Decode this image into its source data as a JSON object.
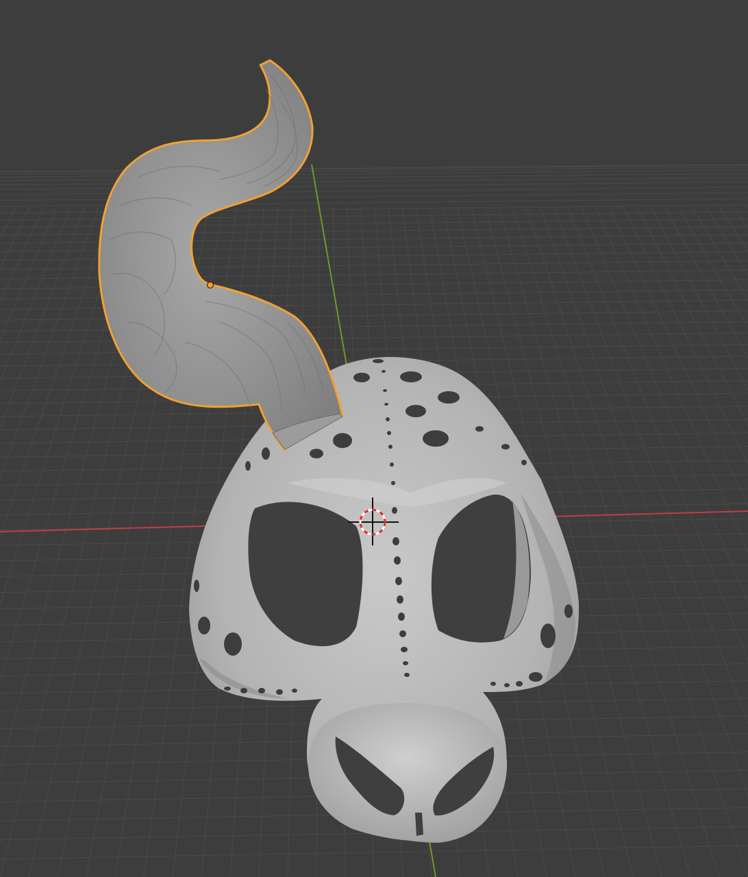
{
  "viewport": {
    "background": "#3d3d3d",
    "grid_color": "#4a4a4a",
    "x_axis_color": "#c43b4a",
    "y_axis_color": "#6c9a2a",
    "selection_outline_color": "#f2a033",
    "origin_dot_color": "#f2a033",
    "cursor_ring_colors": [
      "#e02a2a",
      "#ffffff"
    ],
    "cursor_cross_color": "#111111"
  },
  "scene": {
    "objects": [
      {
        "name": "horn",
        "selected": true,
        "surface_color": "#9a9a9a"
      },
      {
        "name": "mask",
        "selected": false,
        "surface_color": "#b6b6b6"
      }
    ],
    "icons": [
      "3d-cursor-icon",
      "origin-point-icon"
    ]
  }
}
